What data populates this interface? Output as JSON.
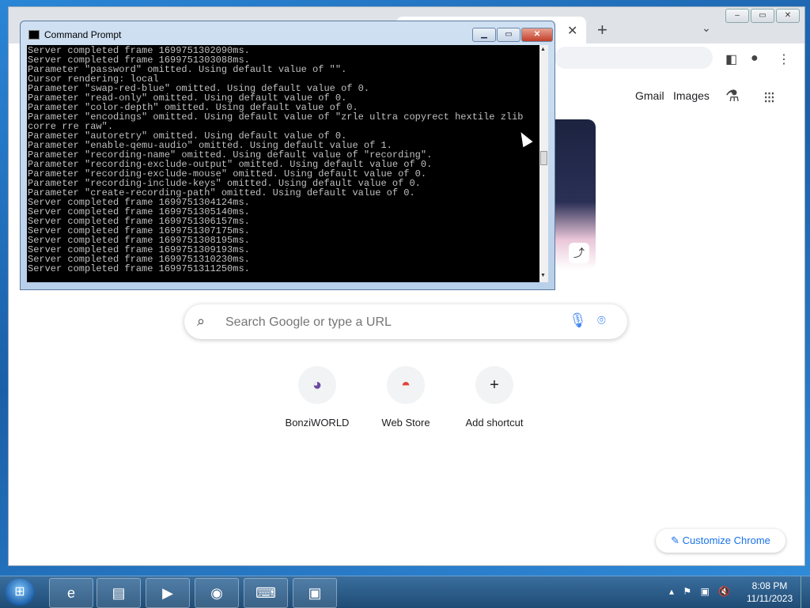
{
  "chrome": {
    "header_links": {
      "gmail": "Gmail",
      "images": "Images"
    },
    "search": {
      "placeholder": "Search Google or type a URL"
    },
    "shortcuts": [
      {
        "label": "BonziWORLD",
        "icon": "bonzi-icon"
      },
      {
        "label": "Web Store",
        "icon": "web-store-icon"
      },
      {
        "label": "Add shortcut",
        "icon": "plus-icon",
        "glyph": "+"
      }
    ],
    "customize_label": "Customize Chrome"
  },
  "cmd": {
    "title": "Command Prompt",
    "lines": [
      "Server completed frame 1699751302090ms.",
      "Server completed frame 1699751303088ms.",
      "Parameter \"password\" omitted. Using default value of \"\".",
      "Cursor rendering: local",
      "Parameter \"swap-red-blue\" omitted. Using default value of 0.",
      "Parameter \"read-only\" omitted. Using default value of 0.",
      "Parameter \"color-depth\" omitted. Using default value of 0.",
      "Parameter \"encodings\" omitted. Using default value of \"zrle ultra copyrect hextile zlib corre rre raw\".",
      "Parameter \"autoretry\" omitted. Using default value of 0.",
      "Parameter \"enable-qemu-audio\" omitted. Using default value of 1.",
      "Parameter \"recording-name\" omitted. Using default value of \"recording\".",
      "Parameter \"recording-exclude-output\" omitted. Using default value of 0.",
      "Parameter \"recording-exclude-mouse\" omitted. Using default value of 0.",
      "Parameter \"recording-include-keys\" omitted. Using default value of 0.",
      "Parameter \"create-recording-path\" omitted. Using default value of 0.",
      "Server completed frame 1699751304124ms.",
      "Server completed frame 1699751305140ms.",
      "Server completed frame 1699751306157ms.",
      "Server completed frame 1699751307175ms.",
      "Server completed frame 1699751308195ms.",
      "Server completed frame 1699751309193ms.",
      "Server completed frame 1699751310230ms.",
      "Server completed frame 1699751311250ms."
    ]
  },
  "taskbar": {
    "apps": [
      {
        "name": "internet-explorer",
        "glyph": "e"
      },
      {
        "name": "file-explorer",
        "glyph": "▤"
      },
      {
        "name": "media-player",
        "glyph": "▶"
      },
      {
        "name": "chrome",
        "glyph": "◉"
      },
      {
        "name": "on-screen-keyboard",
        "glyph": "⌨"
      },
      {
        "name": "command-prompt",
        "glyph": "▣"
      }
    ],
    "clock": {
      "time": "8:08 PM",
      "date": "11/11/2023"
    }
  }
}
